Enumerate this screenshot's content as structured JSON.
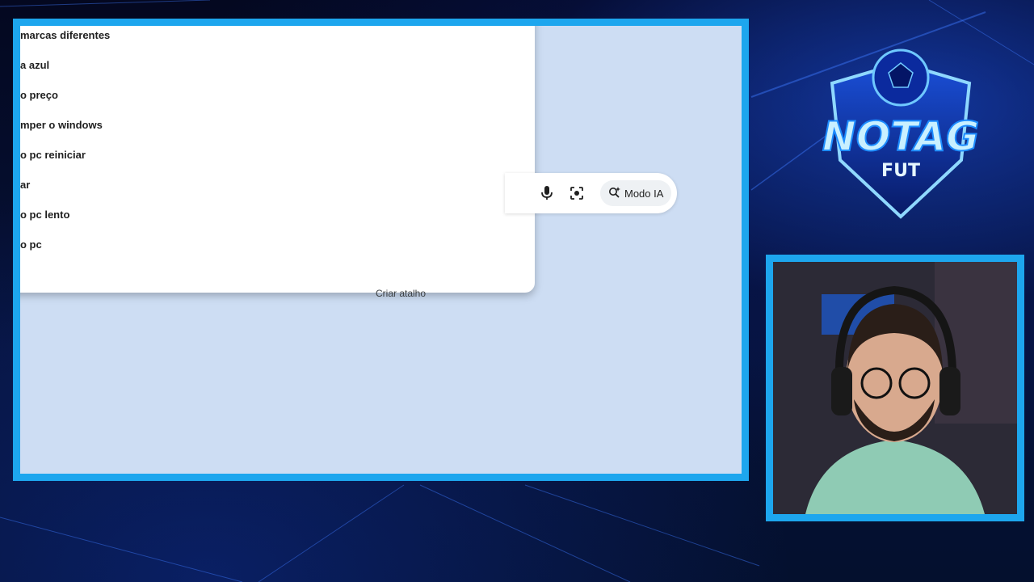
{
  "browser": {
    "suggestions": [
      "marcas diferentes",
      "a azul",
      "o preço",
      "mper o windows",
      "o pc reiniciar",
      "ar",
      "o pc lento",
      "o pc"
    ],
    "search_bar": {
      "mode_ia_label": "Modo IA"
    },
    "create_shortcut_label": "Criar atalho"
  },
  "overlay": {
    "logo": {
      "title": "NOTAG",
      "subtitle": "FUT"
    }
  },
  "colors": {
    "frame_accent": "#1da6ee",
    "viewport_bg": "#cdddf3"
  }
}
